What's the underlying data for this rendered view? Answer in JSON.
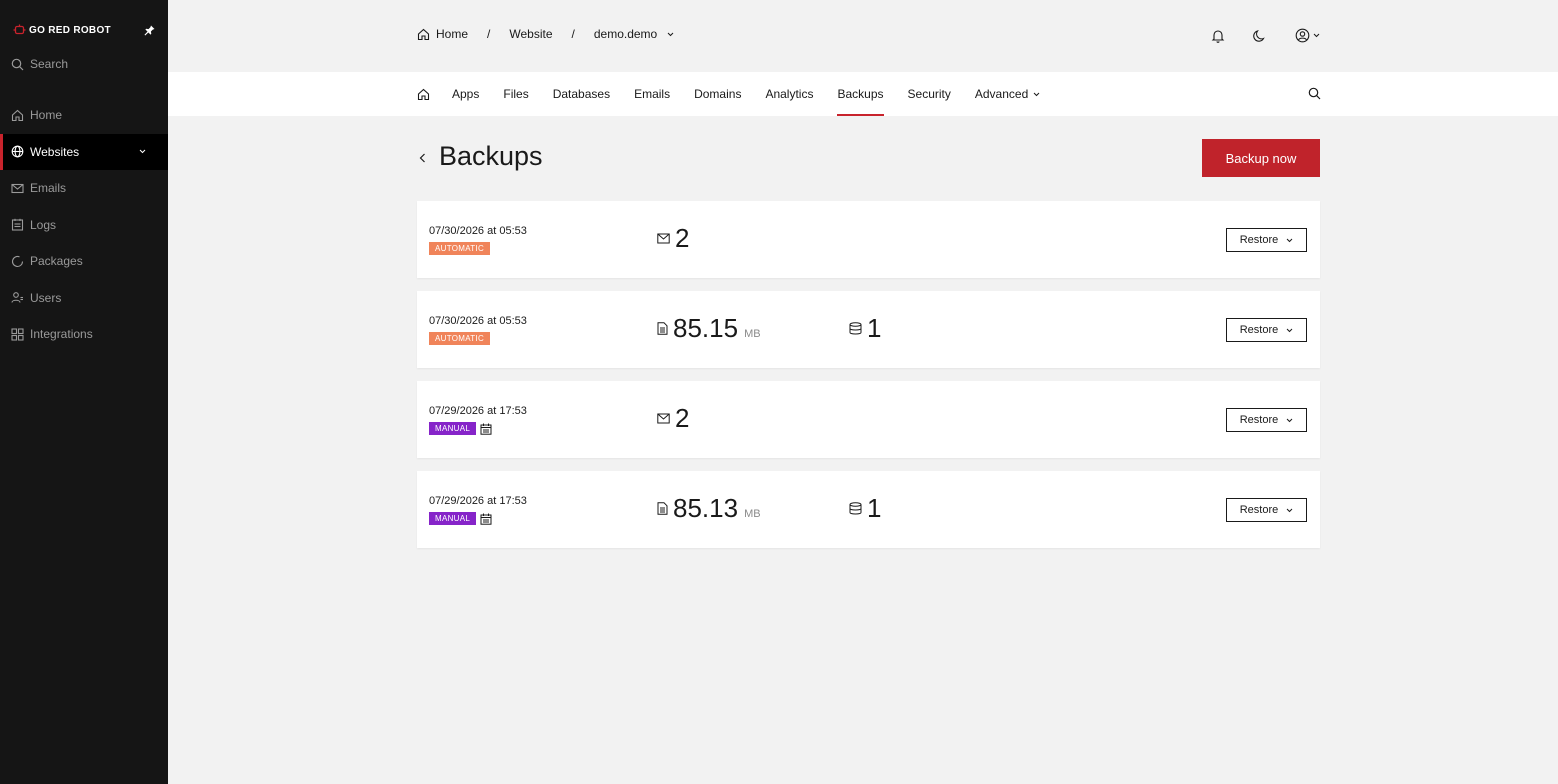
{
  "brand": {
    "name": "GO RED ROBOT",
    "accent": "#c8232c"
  },
  "sidebar": {
    "search_label": "Search",
    "items": [
      {
        "label": "Home",
        "icon": "home-icon"
      },
      {
        "label": "Websites",
        "icon": "globe-icon",
        "active": true
      },
      {
        "label": "Emails",
        "icon": "mail-icon"
      },
      {
        "label": "Logs",
        "icon": "log-icon"
      },
      {
        "label": "Packages",
        "icon": "package-icon"
      },
      {
        "label": "Users",
        "icon": "users-icon"
      },
      {
        "label": "Integrations",
        "icon": "integrations-icon"
      }
    ]
  },
  "breadcrumb": {
    "home": "Home",
    "section": "Website",
    "site": "demo.demo"
  },
  "tabs": [
    {
      "label": "Apps"
    },
    {
      "label": "Files"
    },
    {
      "label": "Databases"
    },
    {
      "label": "Emails"
    },
    {
      "label": "Domains"
    },
    {
      "label": "Analytics"
    },
    {
      "label": "Backups",
      "active": true
    },
    {
      "label": "Security"
    },
    {
      "label": "Advanced"
    }
  ],
  "page": {
    "title": "Backups",
    "backup_now_label": "Backup now"
  },
  "backups": [
    {
      "date": "07/30/2026 at 05:53",
      "type": "AUTOMATIC",
      "emails": "2"
    },
    {
      "date": "07/30/2026 at 05:53",
      "type": "AUTOMATIC",
      "files_size": "85.15",
      "files_unit": "MB",
      "databases": "1"
    },
    {
      "date": "07/29/2026 at 17:53",
      "type": "MANUAL",
      "emails": "2"
    },
    {
      "date": "07/29/2026 at 17:53",
      "type": "MANUAL",
      "files_size": "85.13",
      "files_unit": "MB",
      "databases": "1"
    }
  ],
  "restore_label": "Restore",
  "colors": {
    "automatic_badge": "#f0845a",
    "manual_badge": "#8624c9",
    "primary_button": "#c0232b"
  }
}
